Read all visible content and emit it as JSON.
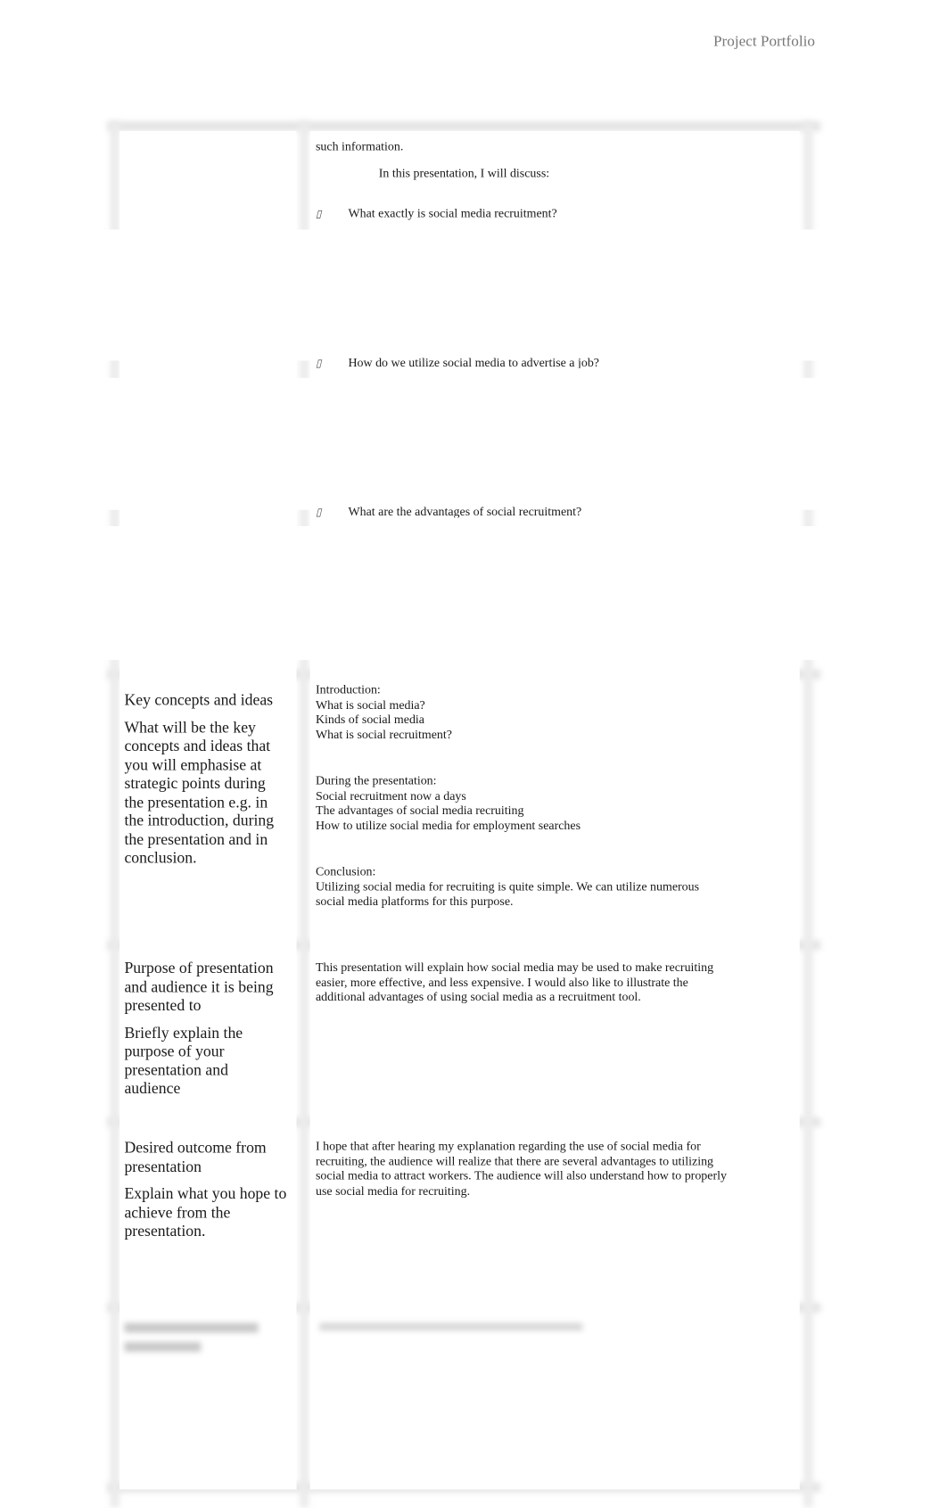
{
  "header": {
    "title": "Project Portfolio"
  },
  "row1": {
    "continued_text": "such information.",
    "intro": "In this presentation, I will discuss:",
    "bullet_glyph": "▯",
    "bullets": [
      "What exactly is social media recruitment?",
      "How do we utilize social media to advertise a job?",
      "What are the advantages of social recruitment?"
    ]
  },
  "rows": [
    {
      "label_title": "Key concepts and ideas",
      "label_prompt": "What will be the key concepts and ideas that you will emphasise at strategic points during the presentation e.g. in the introduction, during the presentation and in conclusion.",
      "content": {
        "intro_heading": "Introduction:",
        "intro_items": [
          "What is social media?",
          "Kinds of social media",
          "What is social recruitment?"
        ],
        "during_heading": "During the presentation:",
        "during_items": [
          "Social recruitment now a days",
          "The advantages of social media recruiting",
          "How to utilize social media for employment searches"
        ],
        "conclusion_heading": "Conclusion:",
        "conclusion_text": "Utilizing social media for recruiting is quite simple. We can utilize numerous social media platforms for this purpose."
      }
    },
    {
      "label_title": "Purpose of presentation and audience it is being presented to",
      "label_prompt": "Briefly explain the purpose of your presentation and audience",
      "content": "This presentation will explain how social media may be used to make recruiting easier, more effective, and less expensive. I would also like to illustrate the additional advantages of using social media as a recruitment tool."
    },
    {
      "label_title": "Desired outcome from presentation",
      "label_prompt": "Explain what you hope to achieve from the presentation.",
      "content": "I hope that after hearing my explanation regarding the use of social media for recruiting, the audience will realize that there are several advantages to utilizing social media to attract workers. The audience will also understand how to properly use social media for recruiting."
    }
  ]
}
